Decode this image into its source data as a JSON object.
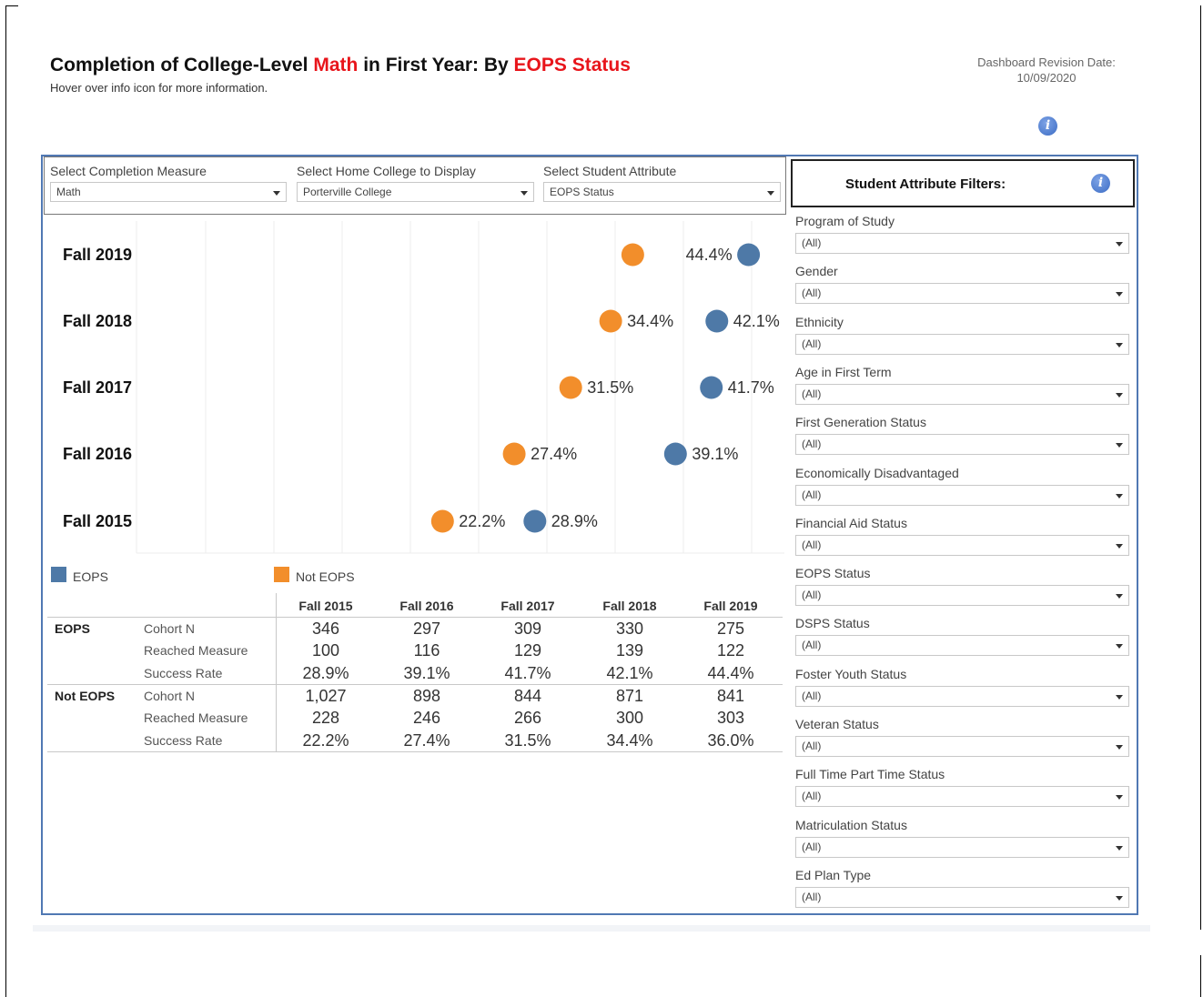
{
  "header": {
    "title_prefix": "Completion of College-Level ",
    "title_measure": "Math",
    "title_middle": " in First Year: By ",
    "title_attribute": "EOPS Status",
    "subtitle": "Hover over info icon for more information.",
    "revision_label": "Dashboard Revision Date:",
    "revision_date": "10/09/2020",
    "info_icon": "i"
  },
  "selectors": [
    {
      "label": "Select Completion Measure",
      "value": "Math"
    },
    {
      "label": "Select Home College to Display",
      "value": "Porterville College"
    },
    {
      "label": "Select Student Attribute",
      "value": "EOPS Status"
    }
  ],
  "colors": {
    "eops": "#4e79a7",
    "not_eops": "#f28e2b",
    "accent_red": "#e8151b",
    "border": "#5078b3"
  },
  "chart_data": {
    "type": "scatter",
    "categories": [
      "Fall 2019",
      "Fall 2018",
      "Fall 2017",
      "Fall 2016",
      "Fall 2015"
    ],
    "series": [
      {
        "name": "EOPS",
        "values": [
          44.4,
          42.1,
          41.7,
          39.1,
          28.9
        ],
        "labels": [
          "44.4%",
          "42.1%",
          "41.7%",
          "39.1%",
          "28.9%"
        ]
      },
      {
        "name": "Not EOPS",
        "values": [
          36.0,
          34.4,
          31.5,
          27.4,
          22.2
        ],
        "labels": [
          "",
          "34.4%",
          "31.5%",
          "27.4%",
          "22.2%"
        ]
      }
    ],
    "xlim": [
      0,
      47
    ],
    "grid": true
  },
  "legend": [
    {
      "label": "EOPS",
      "color": "#4e79a7"
    },
    {
      "label": "Not EOPS",
      "color": "#f28e2b"
    }
  ],
  "table": {
    "columns": [
      "Fall 2015",
      "Fall 2016",
      "Fall 2017",
      "Fall 2018",
      "Fall 2019"
    ],
    "groups": [
      {
        "name": "EOPS",
        "rows": [
          {
            "metric": "Cohort N",
            "values": [
              "346",
              "297",
              "309",
              "330",
              "275"
            ]
          },
          {
            "metric": "Reached Measure",
            "values": [
              "100",
              "116",
              "129",
              "139",
              "122"
            ]
          },
          {
            "metric": "Success Rate",
            "values": [
              "28.9%",
              "39.1%",
              "41.7%",
              "42.1%",
              "44.4%"
            ]
          }
        ]
      },
      {
        "name": "Not EOPS",
        "rows": [
          {
            "metric": "Cohort N",
            "values": [
              "1,027",
              "898",
              "844",
              "871",
              "841"
            ]
          },
          {
            "metric": "Reached Measure",
            "values": [
              "228",
              "246",
              "266",
              "300",
              "303"
            ]
          },
          {
            "metric": "Success Rate",
            "values": [
              "22.2%",
              "27.4%",
              "31.5%",
              "34.4%",
              "36.0%"
            ]
          }
        ]
      }
    ]
  },
  "filters": {
    "title": "Student Attribute Filters:",
    "items": [
      {
        "label": "Program of Study",
        "value": "(All)"
      },
      {
        "label": "Gender",
        "value": "(All)"
      },
      {
        "label": "Ethnicity",
        "value": "(All)"
      },
      {
        "label": "Age in First Term",
        "value": "(All)"
      },
      {
        "label": "First Generation Status",
        "value": "(All)"
      },
      {
        "label": "Economically Disadvantaged",
        "value": "(All)"
      },
      {
        "label": "Financial Aid Status",
        "value": "(All)"
      },
      {
        "label": "EOPS Status",
        "value": "(All)"
      },
      {
        "label": "DSPS Status",
        "value": "(All)"
      },
      {
        "label": "Foster Youth Status",
        "value": "(All)"
      },
      {
        "label": "Veteran Status",
        "value": "(All)"
      },
      {
        "label": "Full Time Part Time Status",
        "value": "(All)"
      },
      {
        "label": "Matriculation Status",
        "value": "(All)"
      },
      {
        "label": "Ed Plan Type",
        "value": "(All)"
      }
    ]
  }
}
